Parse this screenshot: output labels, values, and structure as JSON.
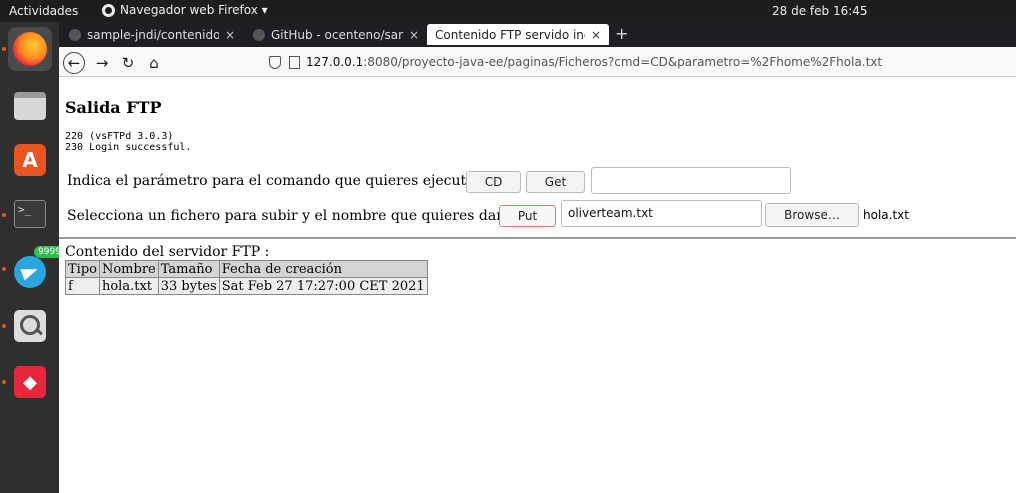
{
  "topbar": {
    "activities": "Actividades",
    "app_name": "Navegador web Firefox ▾",
    "clock": "28 de feb  16:45"
  },
  "dock": {
    "telegram_badge": "9999"
  },
  "browser": {
    "tabs": [
      {
        "label": "sample-jndi/contenido.z",
        "close": "×"
      },
      {
        "label": "GitHub - ocenteno/samp",
        "close": "×"
      },
      {
        "label": "Contenido FTP servido inde",
        "close": "×"
      }
    ],
    "new_tab": "+",
    "url_host": "127.0.0.1",
    "url_rest": ":8080/proyecto-java-ee/paginas/Ficheros?cmd=CD&parametro=%2Fhome%2Fhola.txt"
  },
  "page": {
    "title": "Salida FTP",
    "response_lines": [
      "220 (vsFTPd 3.0.3)",
      "230 Login successful."
    ],
    "command_label": "Indica el parámetro para el comando que quieres ejecutar :",
    "cd_button": "CD",
    "get_button": "Get",
    "param_value": "",
    "upload_label": "Selecciona un fichero para subir y el nombre que quieres darle :",
    "put_button": "Put",
    "upload_name_value": "oliverteam.txt",
    "browse_button": "Browse…",
    "selected_file": "hola.txt",
    "contents_label": "Contenido del servidor FTP :",
    "table": {
      "headers": [
        "Tipo",
        "Nombre",
        "Tamaño",
        "Fecha de creación"
      ],
      "rows": [
        [
          "f",
          "hola.txt",
          "33 bytes",
          "Sat Feb 27 17:27:00 CET 2021"
        ]
      ]
    }
  }
}
